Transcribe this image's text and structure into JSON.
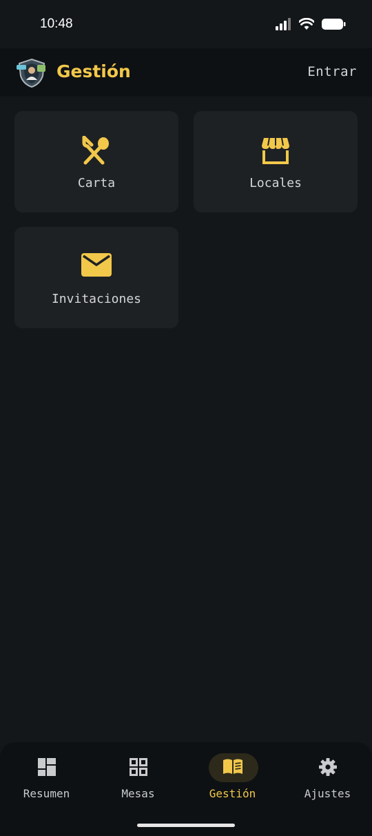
{
  "status_bar": {
    "time": "10:48",
    "icons": [
      "signal-icon",
      "wifi-icon",
      "battery-icon"
    ]
  },
  "app_bar": {
    "title": "Gestión",
    "login_label": "Entrar",
    "logo_icon": "app-logo"
  },
  "tiles": [
    {
      "label": "Carta",
      "icon": "fork-spoon-icon"
    },
    {
      "label": "Locales",
      "icon": "store-icon"
    },
    {
      "label": "Invitaciones",
      "icon": "mail-icon"
    }
  ],
  "bottom_nav": {
    "active_index": 2,
    "items": [
      {
        "label": "Resumen",
        "icon": "dashboard-icon"
      },
      {
        "label": "Mesas",
        "icon": "grid-icon"
      },
      {
        "label": "Gestión",
        "icon": "book-icon"
      },
      {
        "label": "Ajustes",
        "icon": "gear-icon"
      }
    ]
  },
  "colors": {
    "accent": "#f2c84b",
    "background": "#14171a",
    "surface": "#1e2124",
    "bar": "#0e1113",
    "text": "#d4d6d8"
  }
}
